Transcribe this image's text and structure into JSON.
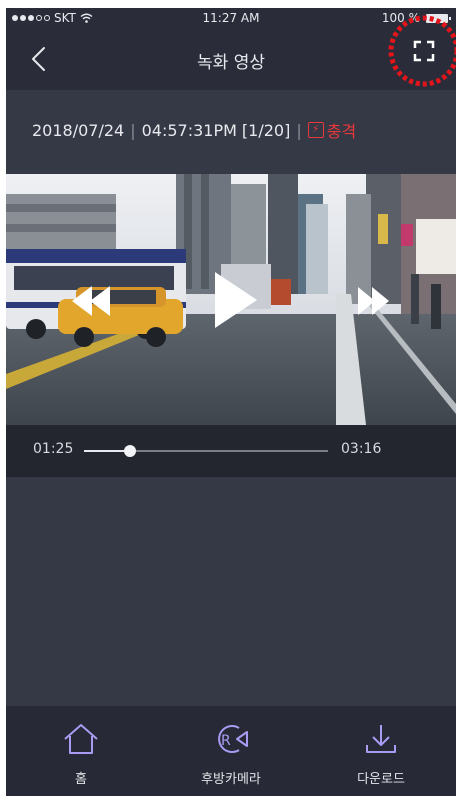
{
  "status_bar": {
    "carrier": "SKT",
    "time": "11:27 AM",
    "battery": "100 %"
  },
  "nav": {
    "title": "녹화 영상"
  },
  "recording": {
    "date": "2018/07/24",
    "time": "04:57:31PM",
    "index": "[1/20]",
    "event_label": "충격"
  },
  "player": {
    "current_time": "01:25",
    "total_time": "03:16",
    "progress": 0.19
  },
  "tabs": [
    {
      "label": "홈",
      "icon": "home-icon"
    },
    {
      "label": "후방카메라",
      "icon": "rear-camera-icon"
    },
    {
      "label": "다운로드",
      "icon": "download-icon"
    }
  ],
  "colors": {
    "accent_purple": "#a99bf2",
    "impact_red": "#e8383b",
    "highlight_circle": "#e3141a"
  }
}
